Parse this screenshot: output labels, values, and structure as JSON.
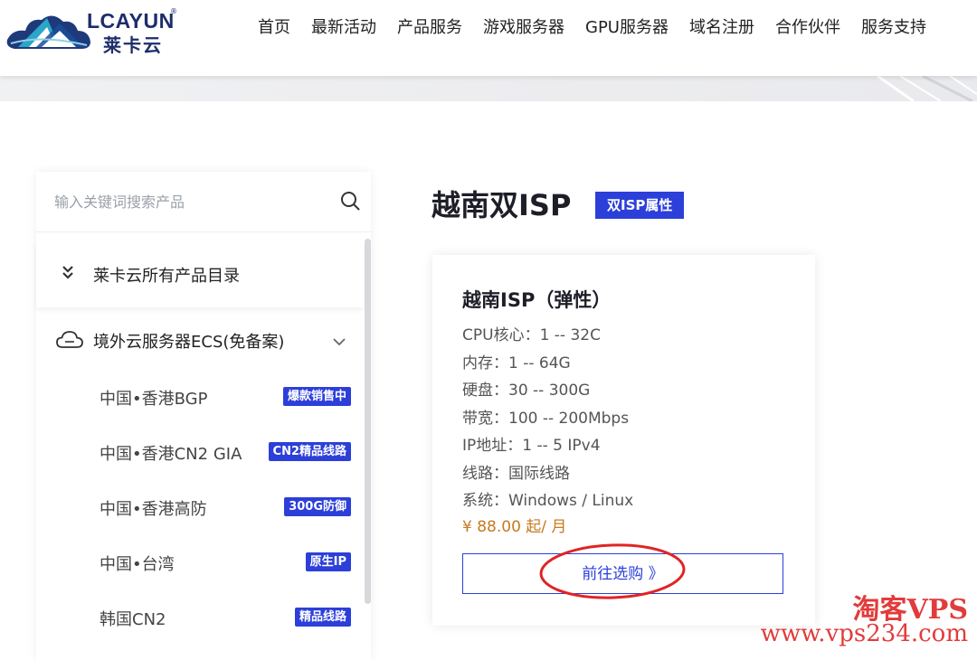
{
  "brand": {
    "en": "LCAYUN",
    "reg": "®",
    "cn": "莱卡云",
    "colors": {
      "primary": "#1d2d6b",
      "accent": "#2c3fd9",
      "price": "#c77a1e"
    }
  },
  "nav": {
    "items": [
      "首页",
      "最新活动",
      "产品服务",
      "游戏服务器",
      "GPU服务器",
      "域名注册",
      "合作伙伴",
      "服务支持"
    ]
  },
  "sidebar": {
    "search": {
      "placeholder": "输入关键词搜索产品",
      "icon": "search-icon"
    },
    "catalog": {
      "label": "莱卡云所有产品目录",
      "icon": "double-chevron-down-icon"
    },
    "category": {
      "label": "境外云服务器ECS(免备案)",
      "icon": "cloud-icon",
      "expand_icon": "chevron-down-icon"
    },
    "items": [
      {
        "label": "中国•香港BGP",
        "badge": "爆款销售中"
      },
      {
        "label": "中国•香港CN2 GIA",
        "badge": "CN2精品线路"
      },
      {
        "label": "中国•香港高防",
        "badge": "300G防御"
      },
      {
        "label": "中国•台湾",
        "badge": "原生IP"
      },
      {
        "label": "韩国CN2",
        "badge": "精品线路"
      }
    ]
  },
  "main": {
    "title": "越南双ISP",
    "title_badge": "双ISP属性",
    "card": {
      "title": "越南ISP（弹性）",
      "specs": [
        "CPU核心：1 -- 32C",
        "内存：1 -- 64G",
        "硬盘：30 -- 300G",
        "带宽：100 -- 200Mbps",
        "IP地址：1 -- 5 IPv4",
        "线路：国际线路",
        "系统：Windows / Linux"
      ],
      "price": "¥ 88.00 起/ 月",
      "button": "前往选购 》"
    }
  },
  "watermark": {
    "line1": "淘客VPS",
    "line2": "www.vps234.com"
  }
}
